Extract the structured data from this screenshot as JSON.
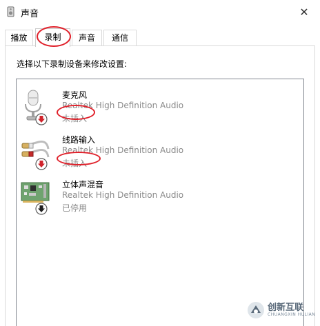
{
  "window": {
    "title": "声音",
    "close_glyph": "✕"
  },
  "tabs": [
    {
      "label": "播放",
      "active": false
    },
    {
      "label": "录制",
      "active": true
    },
    {
      "label": "声音",
      "active": false
    },
    {
      "label": "通信",
      "active": false
    }
  ],
  "panel": {
    "instruction": "选择以下录制设备来修改设置:"
  },
  "devices": [
    {
      "name": "麦克风",
      "driver": "Realtek High Definition Audio",
      "status": "未插入",
      "icon": "microphone-icon",
      "badge": "red-down-arrow"
    },
    {
      "name": "线路输入",
      "driver": "Realtek High Definition Audio",
      "status": "未插入",
      "icon": "line-in-icon",
      "badge": "red-down-arrow"
    },
    {
      "name": "立体声混音",
      "driver": "Realtek High Definition Audio",
      "status": "已停用",
      "icon": "sound-card-icon",
      "badge": "black-down-arrow"
    }
  ],
  "watermark": {
    "brand": "创新互联",
    "sub": "CHUANGXIN HULIAN"
  },
  "colors": {
    "annotation": "#e0202a",
    "status_text": "#8a8a8a",
    "badge_red": "#d0232b"
  }
}
